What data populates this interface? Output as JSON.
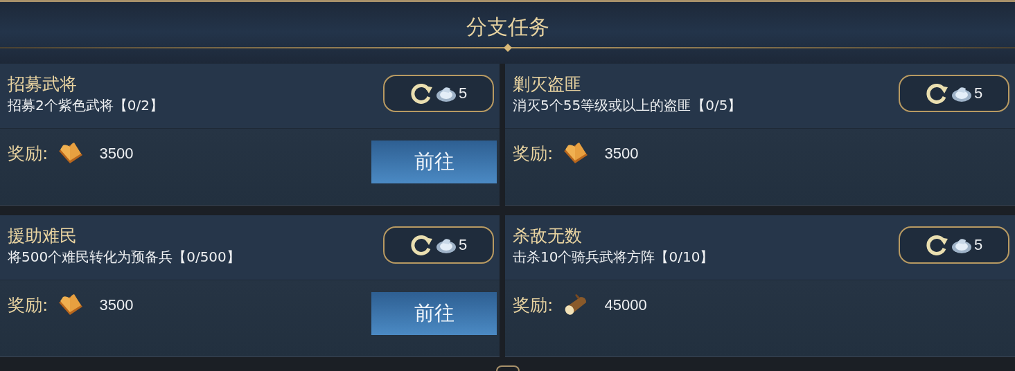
{
  "title": "分支任务",
  "quests": [
    {
      "name": "招募武将",
      "description": "招募2个紫色武将【0/2】",
      "refresh_cost": "5",
      "reward_label": "奖励:",
      "kind": "book",
      "reward_amount": "3500",
      "go_button": "前往"
    },
    {
      "name": "剿灭盗匪",
      "description": "消灭5个55等级或以上的盗匪【0/5】",
      "refresh_cost": "5",
      "reward_label": "奖励:",
      "kind": "book",
      "reward_amount": "3500"
    },
    {
      "name": "援助难民",
      "description": "将500个难民转化为预备兵【0/500】",
      "refresh_cost": "5",
      "reward_label": "奖励:",
      "kind": "book",
      "reward_amount": "3500",
      "go_button": "前往"
    },
    {
      "name": "杀敌无数",
      "description": "击杀10个骑兵武将方阵【0/10】",
      "refresh_cost": "5",
      "reward_label": "奖励:",
      "kind": "wood",
      "reward_amount": "45000"
    }
  ]
}
